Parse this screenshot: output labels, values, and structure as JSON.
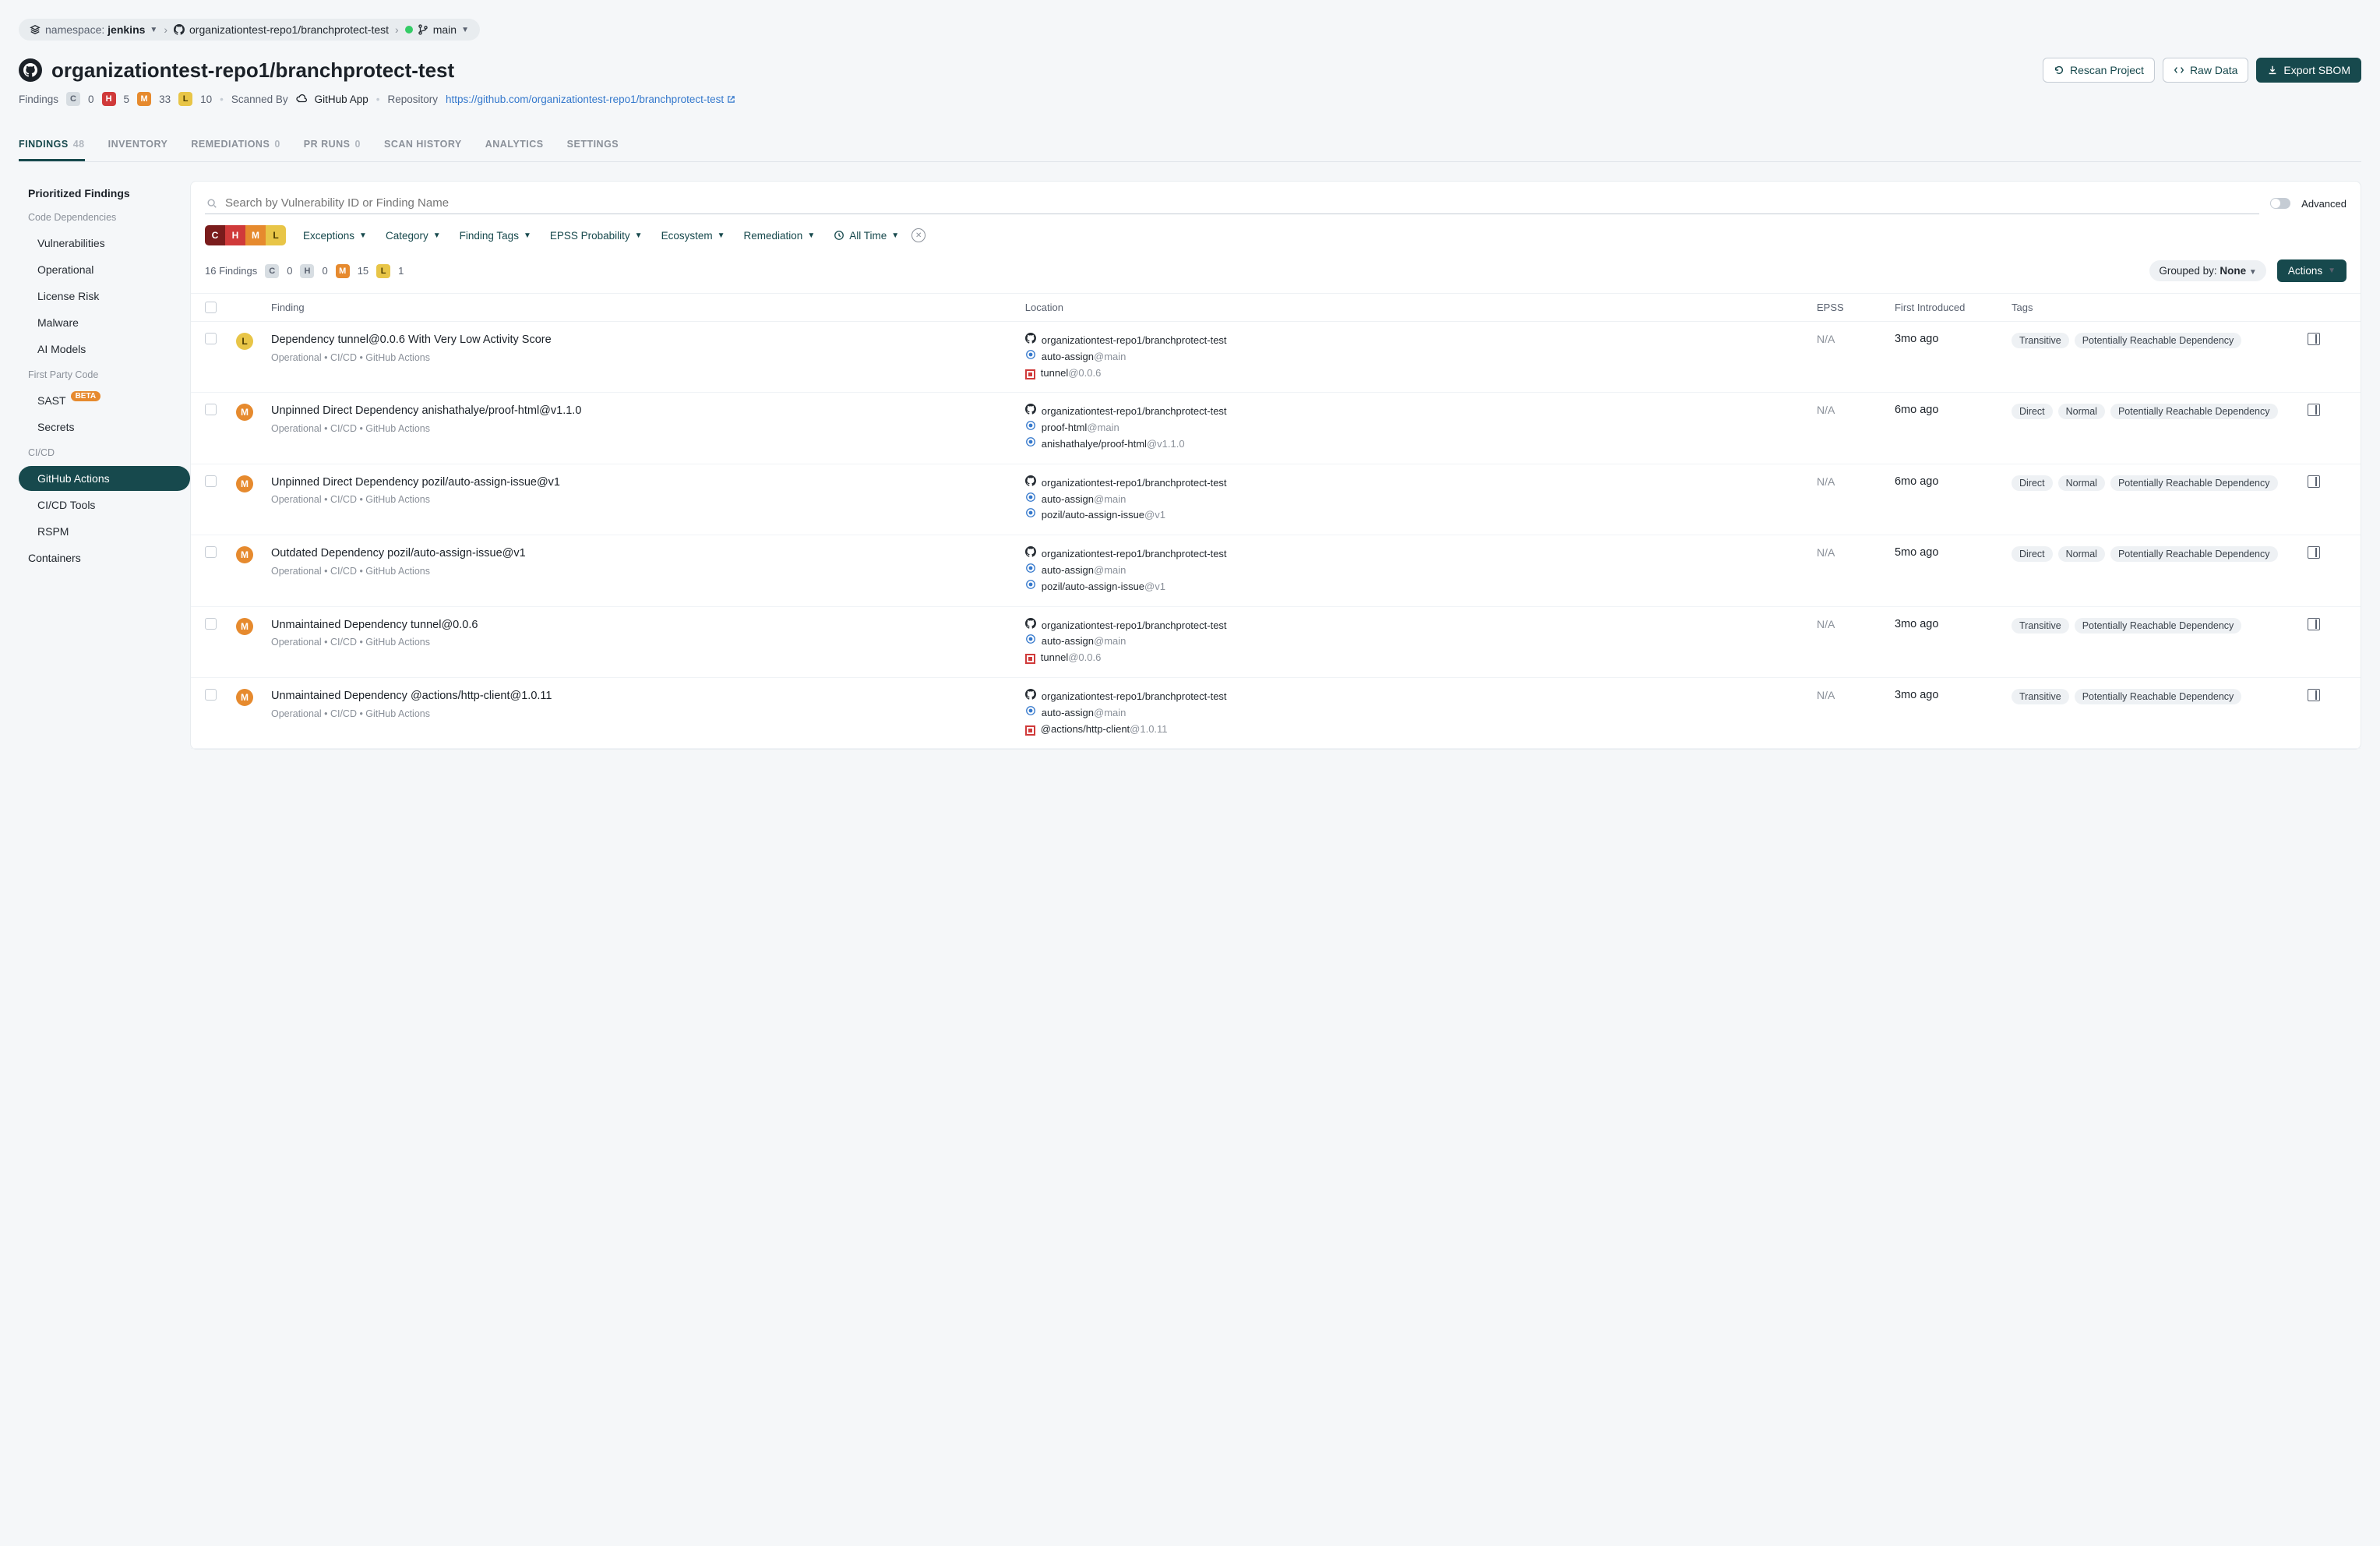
{
  "breadcrumb": {
    "namespace_label": "namespace:",
    "namespace_value": "jenkins",
    "repo": "organizationtest-repo1/branchprotect-test",
    "branch": "main"
  },
  "page_title": "organizationtest-repo1/branchprotect-test",
  "header_actions": {
    "rescan": "Rescan Project",
    "raw_data": "Raw Data",
    "export_sbom": "Export SBOM"
  },
  "meta": {
    "findings_label": "Findings",
    "crit_count": "0",
    "high_count": "5",
    "med_count": "33",
    "low_count": "10",
    "scanned_by_label": "Scanned By",
    "scanned_by_app": "GitHub App",
    "repository_label": "Repository",
    "repository_link": "https://github.com/organizationtest-repo1/branchprotect-test"
  },
  "tabs": [
    {
      "label": "FINDINGS",
      "count": "48"
    },
    {
      "label": "INVENTORY",
      "count": ""
    },
    {
      "label": "REMEDIATIONS",
      "count": "0"
    },
    {
      "label": "PR RUNS",
      "count": "0"
    },
    {
      "label": "SCAN HISTORY",
      "count": ""
    },
    {
      "label": "ANALYTICS",
      "count": ""
    },
    {
      "label": "SETTINGS",
      "count": ""
    }
  ],
  "sidebar": {
    "prioritized": "Prioritized Findings",
    "code_deps": "Code Dependencies",
    "vulnerabilities": "Vulnerabilities",
    "operational": "Operational",
    "license_risk": "License Risk",
    "malware": "Malware",
    "ai_models": "AI Models",
    "first_party": "First Party Code",
    "sast": "SAST",
    "beta": "BETA",
    "secrets": "Secrets",
    "cicd": "CI/CD",
    "github_actions": "GitHub Actions",
    "cicd_tools": "CI/CD Tools",
    "rspm": "RSPM",
    "containers": "Containers"
  },
  "search": {
    "placeholder": "Search by Vulnerability ID or Finding Name",
    "advanced_label": "Advanced"
  },
  "severity_chips": {
    "c": "C",
    "h": "H",
    "m": "M",
    "l": "L"
  },
  "filters": {
    "exceptions": "Exceptions",
    "category": "Category",
    "finding_tags": "Finding Tags",
    "epss": "EPSS Probability",
    "ecosystem": "Ecosystem",
    "remediation": "Remediation",
    "all_time": "All Time"
  },
  "status": {
    "findings_count": "16 Findings",
    "c": "0",
    "h": "0",
    "m": "15",
    "l": "1",
    "grouped_by_label": "Grouped by:",
    "grouped_by_value": "None",
    "actions": "Actions"
  },
  "columns": {
    "finding": "Finding",
    "location": "Location",
    "epss": "EPSS",
    "first_introduced": "First Introduced",
    "tags": "Tags"
  },
  "rows": [
    {
      "sev": "low",
      "sev_letter": "L",
      "title": "Dependency tunnel@0.0.6 With Very Low Activity Score",
      "subtype": "Operational  •  CI/CD  •  GitHub Actions",
      "repo_line": "organizationtest-repo1/branchprotect-test",
      "dep1": "auto-assign",
      "dep1_suffix": "@main",
      "pkg": "tunnel",
      "pkg_suffix": "@0.0.6",
      "pkg_icon": "box",
      "epss": "N/A",
      "first_introduced": "3mo ago",
      "tags": [
        "Transitive",
        "Potentially Reachable Dependency"
      ]
    },
    {
      "sev": "med",
      "sev_letter": "M",
      "title": "Unpinned Direct Dependency anishathalye/proof-html@v1.1.0",
      "subtype": "Operational  •  CI/CD  •  GitHub Actions",
      "repo_line": "organizationtest-repo1/branchprotect-test",
      "dep1": "proof-html",
      "dep1_suffix": "@main",
      "pkg": "anishathalye/proof-html",
      "pkg_suffix": "@v1.1.0",
      "pkg_icon": "circle",
      "epss": "N/A",
      "first_introduced": "6mo ago",
      "tags": [
        "Direct",
        "Normal",
        "Potentially Reachable Dependency"
      ]
    },
    {
      "sev": "med",
      "sev_letter": "M",
      "title": "Unpinned Direct Dependency pozil/auto-assign-issue@v1",
      "subtype": "Operational  •  CI/CD  •  GitHub Actions",
      "repo_line": "organizationtest-repo1/branchprotect-test",
      "dep1": "auto-assign",
      "dep1_suffix": "@main",
      "pkg": "pozil/auto-assign-issue",
      "pkg_suffix": "@v1",
      "pkg_icon": "circle",
      "epss": "N/A",
      "first_introduced": "6mo ago",
      "tags": [
        "Direct",
        "Normal",
        "Potentially Reachable Dependency"
      ]
    },
    {
      "sev": "med",
      "sev_letter": "M",
      "title": "Outdated Dependency pozil/auto-assign-issue@v1",
      "subtype": "Operational  •  CI/CD  •  GitHub Actions",
      "repo_line": "organizationtest-repo1/branchprotect-test",
      "dep1": "auto-assign",
      "dep1_suffix": "@main",
      "pkg": "pozil/auto-assign-issue",
      "pkg_suffix": "@v1",
      "pkg_icon": "circle",
      "epss": "N/A",
      "first_introduced": "5mo ago",
      "tags": [
        "Direct",
        "Normal",
        "Potentially Reachable Dependency"
      ]
    },
    {
      "sev": "med",
      "sev_letter": "M",
      "title": "Unmaintained Dependency tunnel@0.0.6",
      "subtype": "Operational  •  CI/CD  •  GitHub Actions",
      "repo_line": "organizationtest-repo1/branchprotect-test",
      "dep1": "auto-assign",
      "dep1_suffix": "@main",
      "pkg": "tunnel",
      "pkg_suffix": "@0.0.6",
      "pkg_icon": "box",
      "epss": "N/A",
      "first_introduced": "3mo ago",
      "tags": [
        "Transitive",
        "Potentially Reachable Dependency"
      ]
    },
    {
      "sev": "med",
      "sev_letter": "M",
      "title": "Unmaintained Dependency @actions/http-client@1.0.11",
      "subtype": "Operational  •  CI/CD  •  GitHub Actions",
      "repo_line": "organizationtest-repo1/branchprotect-test",
      "dep1": "auto-assign",
      "dep1_suffix": "@main",
      "pkg": "@actions/http-client",
      "pkg_suffix": "@1.0.11",
      "pkg_icon": "box",
      "epss": "N/A",
      "first_introduced": "3mo ago",
      "tags": [
        "Transitive",
        "Potentially Reachable Dependency"
      ]
    }
  ]
}
